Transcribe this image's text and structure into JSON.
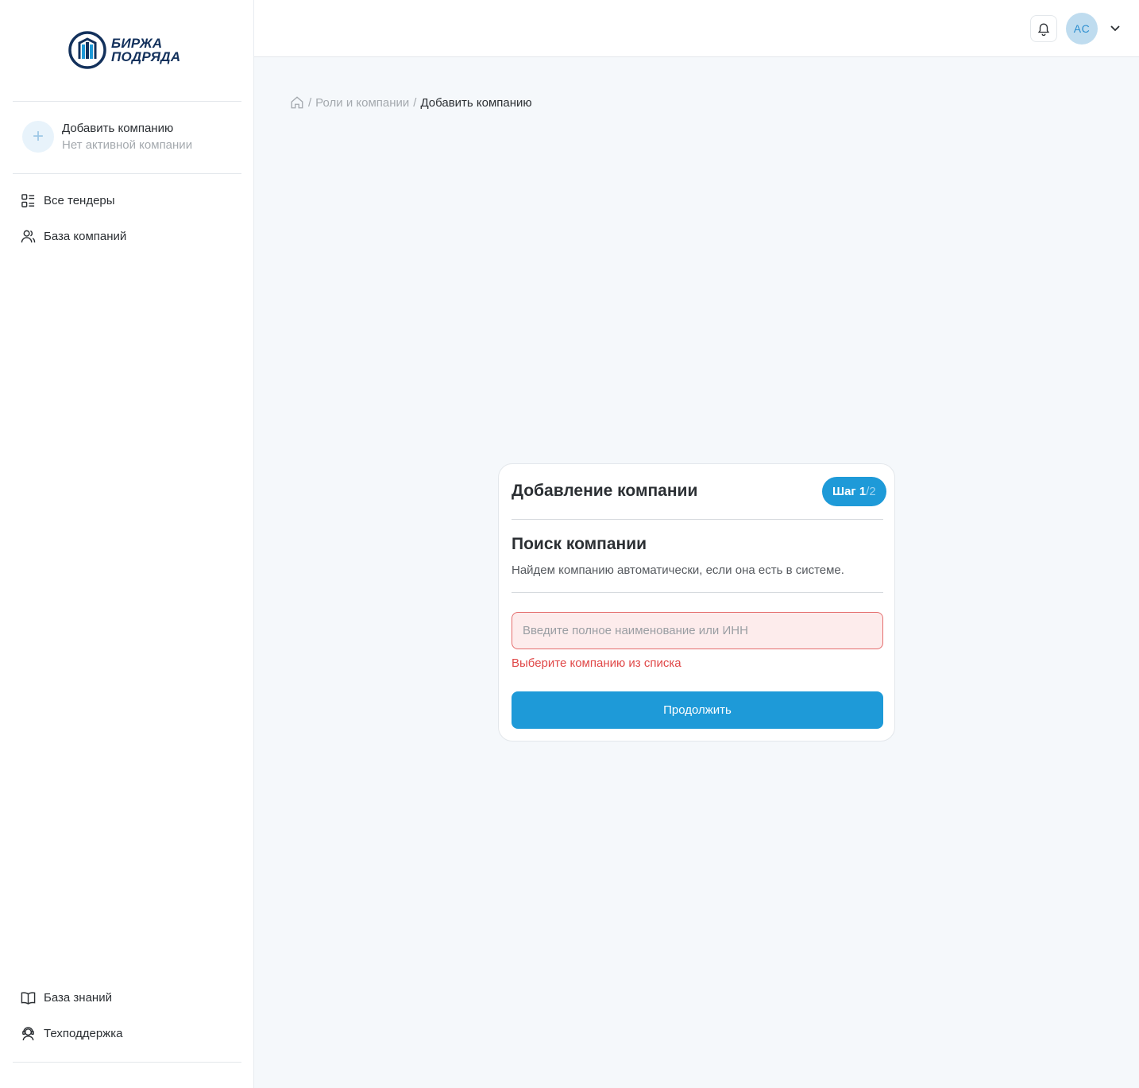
{
  "brand": {
    "line1": "БИРЖА",
    "line2": "ПОДРЯДА",
    "color": "#13315c",
    "accent": "#1e9ad8"
  },
  "sidebar": {
    "company": {
      "icon": "plus-icon",
      "title": "Добавить компанию",
      "subtitle": "Нет активной компании"
    },
    "nav": [
      {
        "icon": "list-icon",
        "label": "Все тендеры"
      },
      {
        "icon": "users-icon",
        "label": "База компаний"
      }
    ],
    "footer": [
      {
        "icon": "book-icon",
        "label": "База знаний"
      },
      {
        "icon": "headset-icon",
        "label": "Техподдержка"
      }
    ]
  },
  "header": {
    "avatar_initials": "AC",
    "bell_icon": "bell-icon",
    "menu_icon": "chevron-down-icon"
  },
  "breadcrumb": {
    "home_icon": "home-icon",
    "separator": "/",
    "items": [
      "Роли и компании",
      "Добавить компанию"
    ]
  },
  "card": {
    "title": "Добавление компании",
    "step": {
      "current": "Шаг 1",
      "total": "/2"
    },
    "section_title": "Поиск компании",
    "section_desc": "Найдем компанию автоматически, если она есть в системе.",
    "search": {
      "value": "",
      "placeholder": "Введите полное наименование или ИНН"
    },
    "error": "Выберите компанию из списка",
    "continue_label": "Продолжить"
  }
}
